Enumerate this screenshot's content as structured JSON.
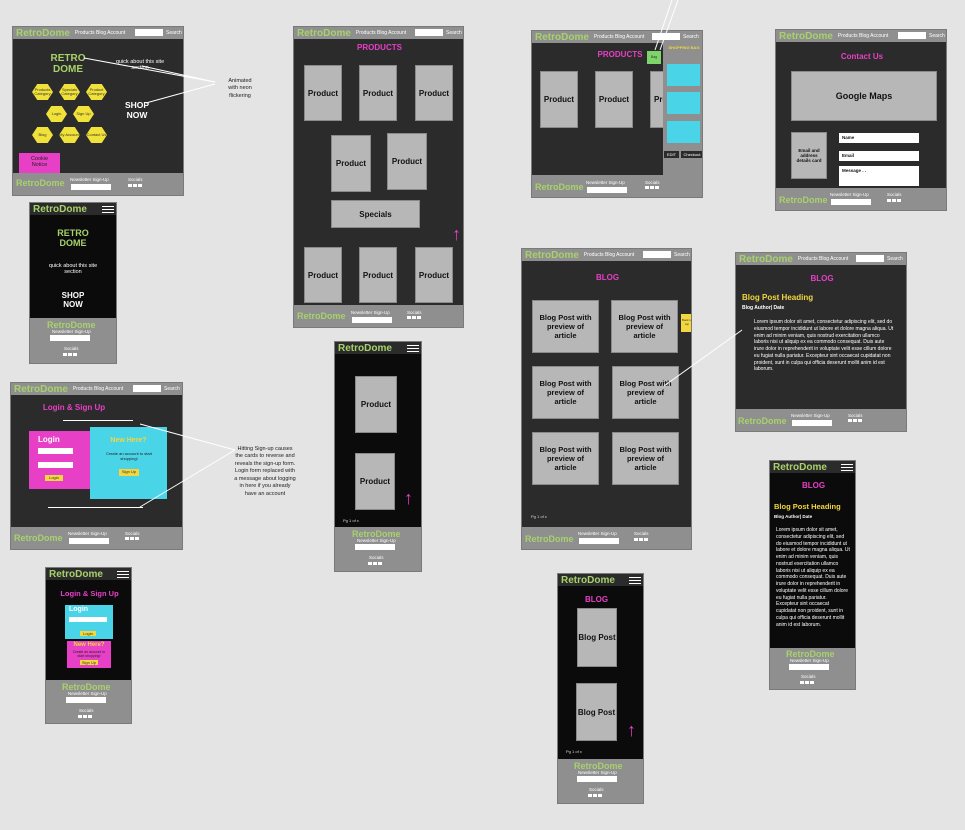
{
  "brand": "RetroDome",
  "nav": "Products Blog  Account",
  "search": "Search",
  "newsletter": "Newsletter Sign-Up",
  "socials": "Socials",
  "home": {
    "hero": "RETRO\nDOME",
    "about": "quick about this site section",
    "shop": "SHOP\nNOW",
    "cookie": "Cookie\nNotice",
    "hexes": [
      "Products Category",
      "Specials Category",
      "Product Category",
      "Login",
      "Sign Up",
      "Blog",
      "My Account",
      "Contact Us"
    ]
  },
  "home_mobile": {
    "hero": "RETRO\nDOME",
    "about": "quick about this site section",
    "shop": "SHOP\nNOW"
  },
  "annotations": {
    "neon": "Animated\nwith neon\nflickering",
    "signup": "Hitting Sign-up causes the cards to reverse and reveals the sign-up form. Login form replaced with a message about logging in here if you already have an account"
  },
  "products": {
    "title": "PRODUCTS",
    "product": "Product",
    "specials": "Specials",
    "page": "Pg 1 of x"
  },
  "bag": {
    "title": "PRODUCTS",
    "shopping_bag": "SHOPPING BAG",
    "bag_btn": "Bag",
    "edit": "EDIT",
    "checkout": "Checkout"
  },
  "contact": {
    "title": "Contact Us",
    "maps": "Google Maps",
    "details": "Email and address details card",
    "fields": [
      "Name",
      "Email",
      "Message . ."
    ]
  },
  "login": {
    "title": "Login & Sign Up",
    "login": "Login",
    "login_btn": "Login",
    "new_here": "New Here?",
    "create": "Create an account to start shopping!",
    "signup_btn": "Sign Up"
  },
  "blog": {
    "title": "BLOG",
    "post_preview": "Blog Post with preview of article",
    "post": "Blog Post",
    "page": "Pg 1 of x",
    "side_btn": "Back to top"
  },
  "blogpost": {
    "title": "BLOG",
    "heading": "Blog Post Heading",
    "meta": "Blog Author| Date",
    "lorem": "Lorem ipsum dolor sit amet, consectetur adipiscing elit, sed do eiusmod tempor incididunt ut labore et dolore magna aliqua. Ut enim ad minim veniam, quis nostrud exercitation ullamco laboris nisi ut aliquip ex ea commodo consequat. Duis aute irure dolor in reprehenderit in voluptate velit esse cillum dolore eu fugiat nulla pariatur. Excepteur sint occaecat cupidatat non proident, sunt in culpa qui officia deserunt mollit anim id est laborum."
  },
  "colors": {
    "bg": "#e4e4e4",
    "frame": "#2c2b2b",
    "green": "#a7d26b",
    "magenta": "#e83fc7",
    "yellow": "#f2d73e",
    "cyan": "#49d4e8",
    "grey": "#8f8f8f"
  }
}
